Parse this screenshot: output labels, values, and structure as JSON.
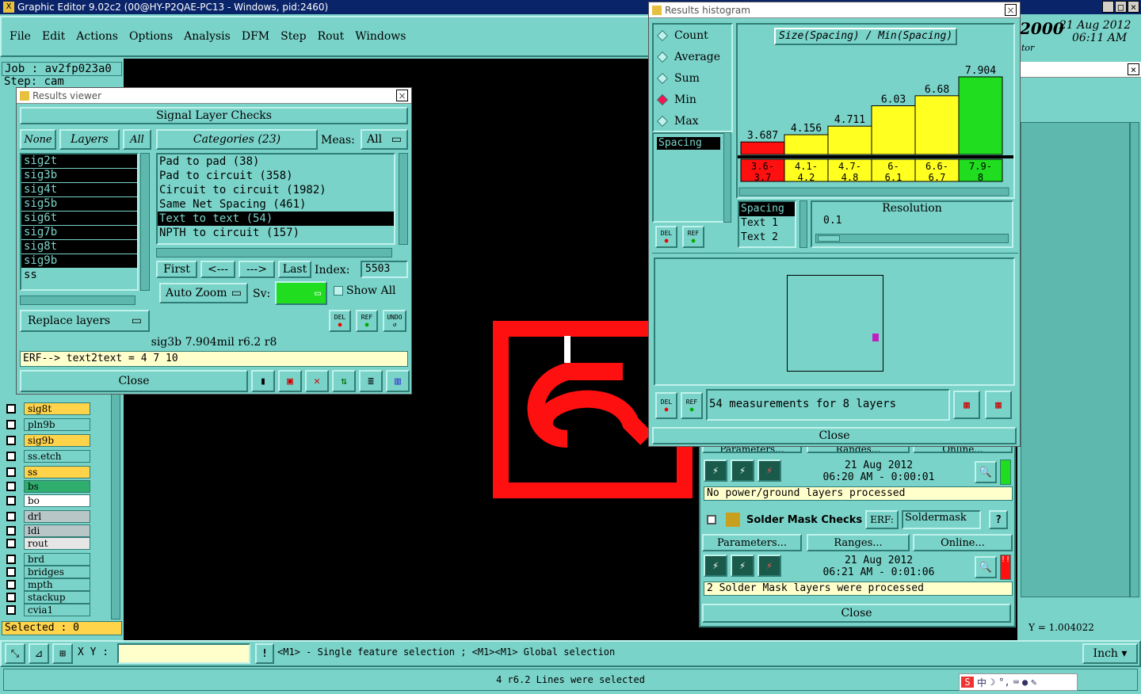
{
  "app": {
    "title": "Graphic Editor 9.02c2 (00@HY-P2QAE-PC13 - Windows, pid:2460)",
    "job": "Job : av2fp023a0",
    "step": "Step: cam",
    "menu": [
      "File",
      "Edit",
      "Actions",
      "Options",
      "Analysis",
      "DFM",
      "Step",
      "Rout",
      "Windows"
    ],
    "datetime": {
      "year": "2000",
      "date": "21 Aug 2012",
      "time": "06:11 AM",
      "sub": "tor"
    },
    "selected": "Selected : 0",
    "xy_label": "X Y :",
    "status": "<M1> - Single feature selection ; <M1><M1> Global selection",
    "units": "Inch",
    "bottom_status": "4 r6.2 Lines were selected",
    "y_readout": "Y = 1.004022"
  },
  "layers": [
    {
      "name": "sig8t",
      "color": "#ffd34a"
    },
    {
      "name": "pln9b",
      "color": "#7ad3c9"
    },
    {
      "name": "sig9b",
      "color": "#ffd34a"
    },
    {
      "name": "ss.etch",
      "color": "#7ad3c9"
    },
    {
      "name": "ss",
      "color": "#ffd34a"
    },
    {
      "name": "bs",
      "color": "#2fae6e"
    },
    {
      "name": "bo",
      "color": "#ffffff"
    },
    {
      "name": "drl",
      "color": "#b9c6c8"
    },
    {
      "name": "ldi",
      "color": "#b9c6c8"
    },
    {
      "name": "rout",
      "color": "#e6e6e6"
    },
    {
      "name": "brd",
      "color": "#7ad3c9"
    },
    {
      "name": "bridges",
      "color": "#7ad3c9"
    },
    {
      "name": "mpth",
      "color": "#7ad3c9"
    },
    {
      "name": "stackup",
      "color": "#7ad3c9"
    },
    {
      "name": "cvia1",
      "color": "#7ad3c9"
    }
  ],
  "viewer": {
    "title": "Results viewer",
    "header": "Signal Layer Checks",
    "none": "None",
    "layers_btn": "Layers",
    "all": "All",
    "categories_btn": "Categories (23)",
    "meas_label": "Meas:",
    "meas_value": "All",
    "layer_list": [
      "sig2t",
      "sig3b",
      "sig4t",
      "sig5b",
      "sig6t",
      "sig7b",
      "sig8t",
      "sig9b",
      "ss"
    ],
    "categories": [
      "Pad to pad (38)",
      "Pad to circuit (358)",
      "Circuit to circuit (1982)",
      "Same Net Spacing (461)",
      "Text to text (54)",
      "NPTH to circuit (157)"
    ],
    "first": "First",
    "prev": "<---",
    "next": "--->",
    "last": "Last",
    "index_label": "Index:",
    "index_value": "5503",
    "auto_zoom": "Auto Zoom",
    "sv_label": "Sv:",
    "show_all": "Show All",
    "replace_layers": "Replace layers",
    "del": "DEL",
    "ref": "REF",
    "undo": "UNDO",
    "info": "sig3b 7.904mil   r6.2   r8",
    "erf": "ERF--> text2text = 4 7 10",
    "close": "Close"
  },
  "histogram": {
    "title": "Results histogram",
    "radios": [
      "Count",
      "Average",
      "Sum",
      "Min",
      "Max"
    ],
    "selected_radio": "Min",
    "chart_title": "Size(Spacing) / Min(Spacing)",
    "param_list": [
      "Spacing"
    ],
    "stats_list": [
      "Spacing",
      "Text  1",
      "Text  2"
    ],
    "resolution_label": "Resolution",
    "resolution_value": "0.1",
    "measurements": "54 measurements for 8 layers",
    "del": "DEL",
    "ref": "REF",
    "close": "Close"
  },
  "chart_data": {
    "type": "bar",
    "title": "Size(Spacing) / Min(Spacing)",
    "categories": [
      "3.6-3.7",
      "4.1-4.2",
      "4.7-4.8",
      "6-6.1",
      "6.6-6.7",
      "7.9-8"
    ],
    "category_labels_top": [
      "3.6-",
      "4.1-",
      "4.7-",
      "6-",
      "6.6-",
      "7.9-"
    ],
    "category_labels_bottom": [
      "3.7",
      "4.2",
      "4.8",
      "6.1",
      "6.7",
      "8"
    ],
    "values": [
      3.687,
      4.156,
      4.711,
      6.03,
      6.68,
      7.904
    ],
    "value_labels": [
      "3.687",
      "4.156",
      "4.711",
      "6.03",
      "6.68",
      "7.904"
    ],
    "colors": [
      "#ff1010",
      "#ffff20",
      "#ffff20",
      "#ffff20",
      "#ffff20",
      "#20dd20"
    ],
    "ylim": [
      0,
      7.904
    ]
  },
  "back_panel": {
    "params": "Parameters...",
    "ranges": "Ranges...",
    "online": "Online...",
    "time1": "21 Aug 2012",
    "time1b": "06:20 AM - 0:00:01",
    "msg1": "No power/ground layers processed",
    "solder": "Solder Mask Checks",
    "erf": "ERF:",
    "erf_value": "Soldermask",
    "help": "?",
    "time2": "21 Aug 2012",
    "time2b": "06:21 AM - 0:01:06",
    "msg2": "2 Solder Mask layers were processed",
    "close": "Close"
  }
}
